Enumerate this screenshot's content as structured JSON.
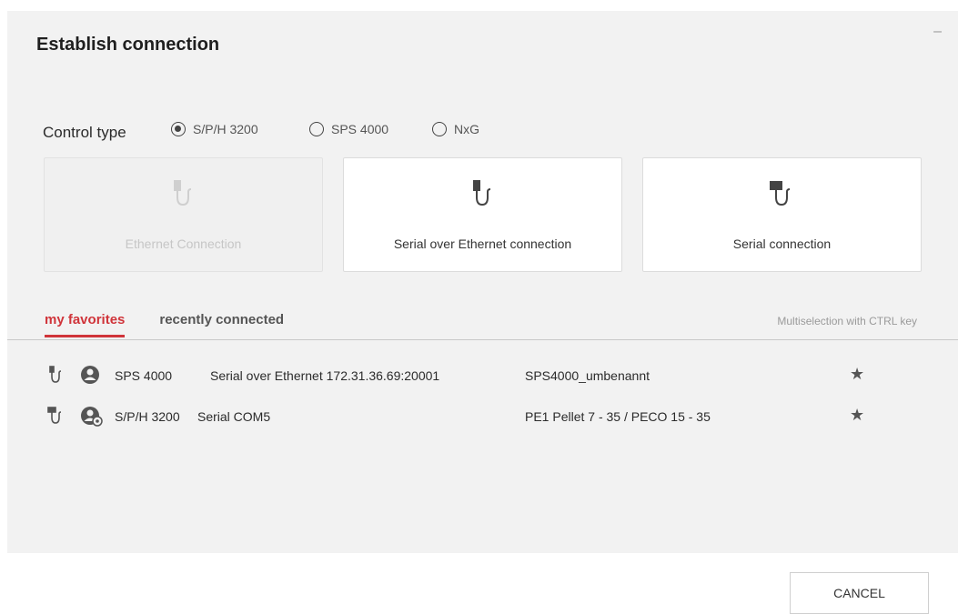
{
  "dialog": {
    "title": "Establish connection",
    "minimize": "–"
  },
  "control_type": {
    "label": "Control type",
    "options": [
      {
        "label": "S/P/H 3200",
        "selected": true
      },
      {
        "label": "SPS 4000",
        "selected": false
      },
      {
        "label": "NxG",
        "selected": false
      }
    ]
  },
  "connections": [
    {
      "label": "Ethernet Connection",
      "icon": "ethernet-plug-icon",
      "enabled": false
    },
    {
      "label": "Serial over Ethernet connection",
      "icon": "ethernet-plug-icon",
      "enabled": true
    },
    {
      "label": "Serial connection",
      "icon": "serial-plug-icon",
      "enabled": true
    }
  ],
  "tabs": {
    "favorites": "my favorites",
    "recent": "recently connected",
    "active": "favorites"
  },
  "hint": "Multiselection with CTRL key",
  "favorites": [
    {
      "control": "SPS 4000",
      "connection": "Serial over Ethernet 172.31.36.69:20001",
      "name": "SPS4000_umbenannt",
      "plug_icon": "ethernet-plug-icon",
      "user_icon": "user-icon"
    },
    {
      "control": "S/P/H 3200",
      "connection": "Serial COM5",
      "name": "PE1 Pellet 7 - 35 / PECO 15 - 35",
      "plug_icon": "serial-plug-icon",
      "user_icon": "user-settings-icon"
    }
  ],
  "buttons": {
    "cancel": "CANCEL"
  },
  "colors": {
    "accent": "#d0343a",
    "panel": "#f2f2f2"
  }
}
